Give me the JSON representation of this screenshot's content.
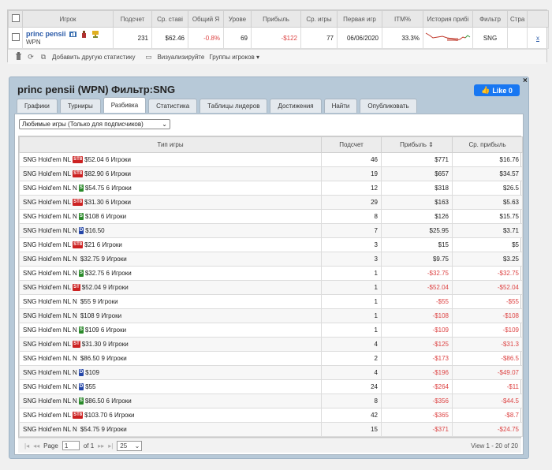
{
  "top": {
    "headers": [
      "",
      "Игрок",
      "Подсчет",
      "Ср. ставі",
      "Общий Я",
      "Урове",
      "Прибыль",
      "Ср. игры",
      "Первая игр",
      "ITM%",
      "История прибі",
      "Фильтр",
      "Стра"
    ],
    "player": {
      "name": "princ pensii",
      "site": "WPN",
      "count": "231",
      "avg_stake": "$62.46",
      "total_roi": "-0.8%",
      "level": "69",
      "profit": "-$122",
      "avg_players": "77",
      "first_game": "06/06/2020",
      "itm": "33.3%",
      "filter": "SNG",
      "page_link": "x"
    },
    "toolbar": {
      "delete_icon": "trash-icon",
      "refresh_icon": "refresh-icon",
      "add_stat_label": "Добавить другую статистику",
      "visualize_label": "Визуализируйте",
      "groups_label": "Группы игроков ▾"
    }
  },
  "main": {
    "title": "princ pensii (WPN) Фильтр:SNG",
    "like_label": "Like 0",
    "close_label": "×",
    "tabs": [
      "Графики",
      "Турниры",
      "Разбивка",
      "Статистика",
      "Таблицы лидеров",
      "Достижения",
      "Найти",
      "Опубликовать"
    ],
    "active_tab": "Разбивка",
    "filter_value": "Любимые игры (Только для подписчиков)",
    "columns": {
      "game_type": "Тип игры",
      "count": "Подсчет",
      "profit": "Прибыль ⇕",
      "avg_profit": "Ср. прибыль"
    },
    "rows": [
      {
        "pre": "SNG Hold'em NL",
        "badge": "ST8",
        "bcls": "st",
        "post": "$52.04 6 Игроки",
        "count": "46",
        "profit": "$771",
        "avg": "$16.76",
        "neg": false
      },
      {
        "pre": "SNG Hold'em NL",
        "badge": "ST8",
        "bcls": "st",
        "post": "$82.90 6 Игроки",
        "count": "19",
        "profit": "$657",
        "avg": "$34.57",
        "neg": false
      },
      {
        "pre": "SNG Hold'em NL N",
        "badge": "S",
        "bcls": "s",
        "post": "$54.75 6 Игроки",
        "count": "12",
        "profit": "$318",
        "avg": "$26.5",
        "neg": false
      },
      {
        "pre": "SNG Hold'em NL",
        "badge": "ST8",
        "bcls": "st",
        "post": "$31.30 6 Игроки",
        "count": "29",
        "profit": "$163",
        "avg": "$5.63",
        "neg": false
      },
      {
        "pre": "SNG Hold'em NL N",
        "badge": "S",
        "bcls": "s",
        "post": "$108 6 Игроки",
        "count": "8",
        "profit": "$126",
        "avg": "$15.75",
        "neg": false
      },
      {
        "pre": "SNG Hold'em NL N",
        "badge": "D",
        "bcls": "d",
        "post": "$16.50",
        "count": "7",
        "profit": "$25.95",
        "avg": "$3.71",
        "neg": false
      },
      {
        "pre": "SNG Hold'em NL",
        "badge": "ST8",
        "bcls": "st",
        "post": "$21 6 Игроки",
        "count": "3",
        "profit": "$15",
        "avg": "$5",
        "neg": false
      },
      {
        "pre": "SNG Hold'em NL N",
        "badge": "",
        "bcls": "",
        "post": "$32.75 9 Игроки",
        "count": "3",
        "profit": "$9.75",
        "avg": "$3.25",
        "neg": false
      },
      {
        "pre": "SNG Hold'em NL N",
        "badge": "S",
        "bcls": "s",
        "post": "$32.75 6 Игроки",
        "count": "1",
        "profit": "-$32.75",
        "avg": "-$32.75",
        "neg": true
      },
      {
        "pre": "SNG Hold'em NL",
        "badge": "ST",
        "bcls": "st",
        "post": "$52.04 9 Игроки",
        "count": "1",
        "profit": "-$52.04",
        "avg": "-$52.04",
        "neg": true
      },
      {
        "pre": "SNG Hold'em NL N",
        "badge": "",
        "bcls": "",
        "post": "$55 9 Игроки",
        "count": "1",
        "profit": "-$55",
        "avg": "-$55",
        "neg": true
      },
      {
        "pre": "SNG Hold'em NL N",
        "badge": "",
        "bcls": "",
        "post": "$108 9 Игроки",
        "count": "1",
        "profit": "-$108",
        "avg": "-$108",
        "neg": true
      },
      {
        "pre": "SNG Hold'em NL N",
        "badge": "S",
        "bcls": "s",
        "post": "$109 6 Игроки",
        "count": "1",
        "profit": "-$109",
        "avg": "-$109",
        "neg": true
      },
      {
        "pre": "SNG Hold'em NL",
        "badge": "ST",
        "bcls": "st",
        "post": "$31.30 9 Игроки",
        "count": "4",
        "profit": "-$125",
        "avg": "-$31.3",
        "neg": true
      },
      {
        "pre": "SNG Hold'em NL N",
        "badge": "",
        "bcls": "",
        "post": "$86.50 9 Игроки",
        "count": "2",
        "profit": "-$173",
        "avg": "-$86.5",
        "neg": true
      },
      {
        "pre": "SNG Hold'em NL N",
        "badge": "D",
        "bcls": "d",
        "post": "$109",
        "count": "4",
        "profit": "-$196",
        "avg": "-$49.07",
        "neg": true
      },
      {
        "pre": "SNG Hold'em NL N",
        "badge": "D",
        "bcls": "d",
        "post": "$55",
        "count": "24",
        "profit": "-$264",
        "avg": "-$11",
        "neg": true
      },
      {
        "pre": "SNG Hold'em NL N",
        "badge": "S",
        "bcls": "s",
        "post": "$86.50 6 Игроки",
        "count": "8",
        "profit": "-$356",
        "avg": "-$44.5",
        "neg": true
      },
      {
        "pre": "SNG Hold'em NL",
        "badge": "ST8",
        "bcls": "st",
        "post": "$103.70 6 Игроки",
        "count": "42",
        "profit": "-$365",
        "avg": "-$8.7",
        "neg": true
      },
      {
        "pre": "SNG Hold'em NL N",
        "badge": "",
        "bcls": "",
        "post": "$54.75 9 Игроки",
        "count": "15",
        "profit": "-$371",
        "avg": "-$24.75",
        "neg": true
      }
    ],
    "pager": {
      "page_label": "Page",
      "page_value": "1",
      "of_label": "of 1",
      "per_page": "25",
      "view_label": "View 1 - 20 of 20"
    }
  }
}
